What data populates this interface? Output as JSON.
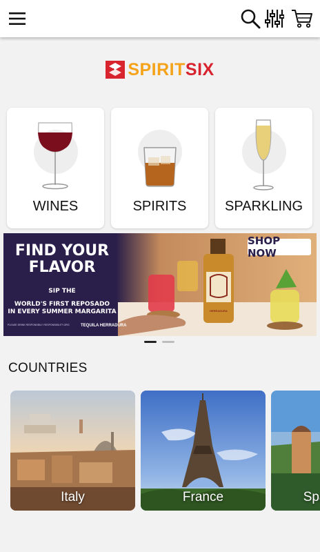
{
  "brand": {
    "part1": "SPIRIT",
    "part2": "SIX"
  },
  "topbar": {
    "menu_icon": "hamburger-menu-icon",
    "search_icon": "search-icon",
    "filter_icon": "filter-sliders-icon",
    "cart_icon": "cart-icon"
  },
  "categories": [
    {
      "label": "WINES",
      "icon": "wine-glass-icon"
    },
    {
      "label": "SPIRITS",
      "icon": "whiskey-glass-icon"
    },
    {
      "label": "SPARKLING",
      "icon": "champagne-flute-icon"
    }
  ],
  "banner": {
    "title_line1": "FIND YOUR",
    "title_line2": "FLAVOR",
    "sub_line1": "SIP THE",
    "sub_line2": "WORLD'S FIRST REPOSADO",
    "sub_line3": "IN EVERY SUMMER MARGARITA",
    "cta": "SHOP NOW",
    "fine_print": "PLEASE DRINK RESPONSIBLY. RESPONSIBILITY.ORG",
    "brand_name": "TEQUILA HERRADURA",
    "bottle_label": "HERRADURA",
    "pages": 2,
    "active_page": 1
  },
  "countries_section": {
    "title": "COUNTRIES",
    "items": [
      {
        "name": "Italy"
      },
      {
        "name": "France"
      },
      {
        "name": "Spain"
      }
    ]
  },
  "colors": {
    "brand_red": "#d7242e",
    "brand_orange": "#f5a31a",
    "banner_bg": "#2a1f4a"
  }
}
